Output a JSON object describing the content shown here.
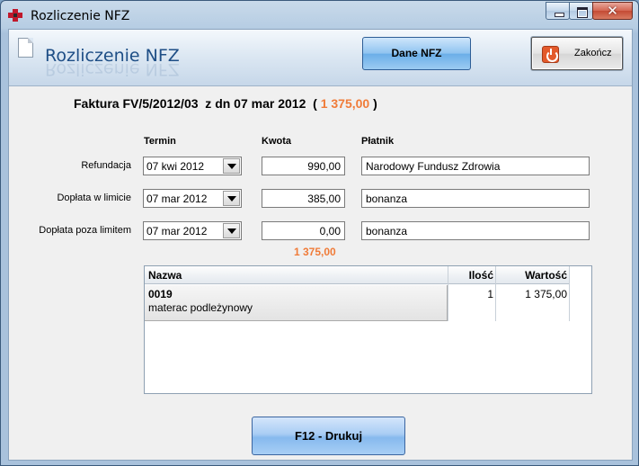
{
  "window": {
    "title": "Rozliczenie NFZ",
    "close_glyph": "✕"
  },
  "header": {
    "title": "Rozliczenie NFZ",
    "dane_button": "Dane NFZ",
    "zakoncz_button": "Zakończ"
  },
  "invoice": {
    "label": "Faktura FV/5/2012/03  z dn 07 mar 2012  ( ",
    "amount": "1 375,00",
    "close_paren": " )"
  },
  "columns": {
    "termin": "Termin",
    "kwota": "Kwota",
    "platnik": "Płatnik"
  },
  "rows": [
    {
      "label": "Refundacja",
      "date": "07 kwi 2012",
      "amount": "990,00",
      "payer": "Narodowy Fundusz Zdrowia"
    },
    {
      "label": "Dopłata w limicie",
      "date": "07 mar 2012",
      "amount": "385,00",
      "payer": "bonanza"
    },
    {
      "label": "Dopłata poza limitem",
      "date": "07 mar 2012",
      "amount": "0,00",
      "payer": "bonanza"
    }
  ],
  "total": "1 375,00",
  "grid": {
    "headers": {
      "name": "Nazwa",
      "qty": "Ilość",
      "value": "Wartość"
    },
    "items": [
      {
        "code": "0019",
        "description": "materac podleżynowy",
        "qty": "1",
        "value": "1 375,00"
      }
    ]
  },
  "print_button": "F12 - Drukuj",
  "colors": {
    "accent_orange": "#f07b38",
    "title_blue": "#1e4e86"
  },
  "icons": [
    "app-logo-icon",
    "minimize-icon",
    "maximize-icon",
    "close-icon",
    "document-icon",
    "power-icon",
    "dropdown-arrow-icon"
  ]
}
